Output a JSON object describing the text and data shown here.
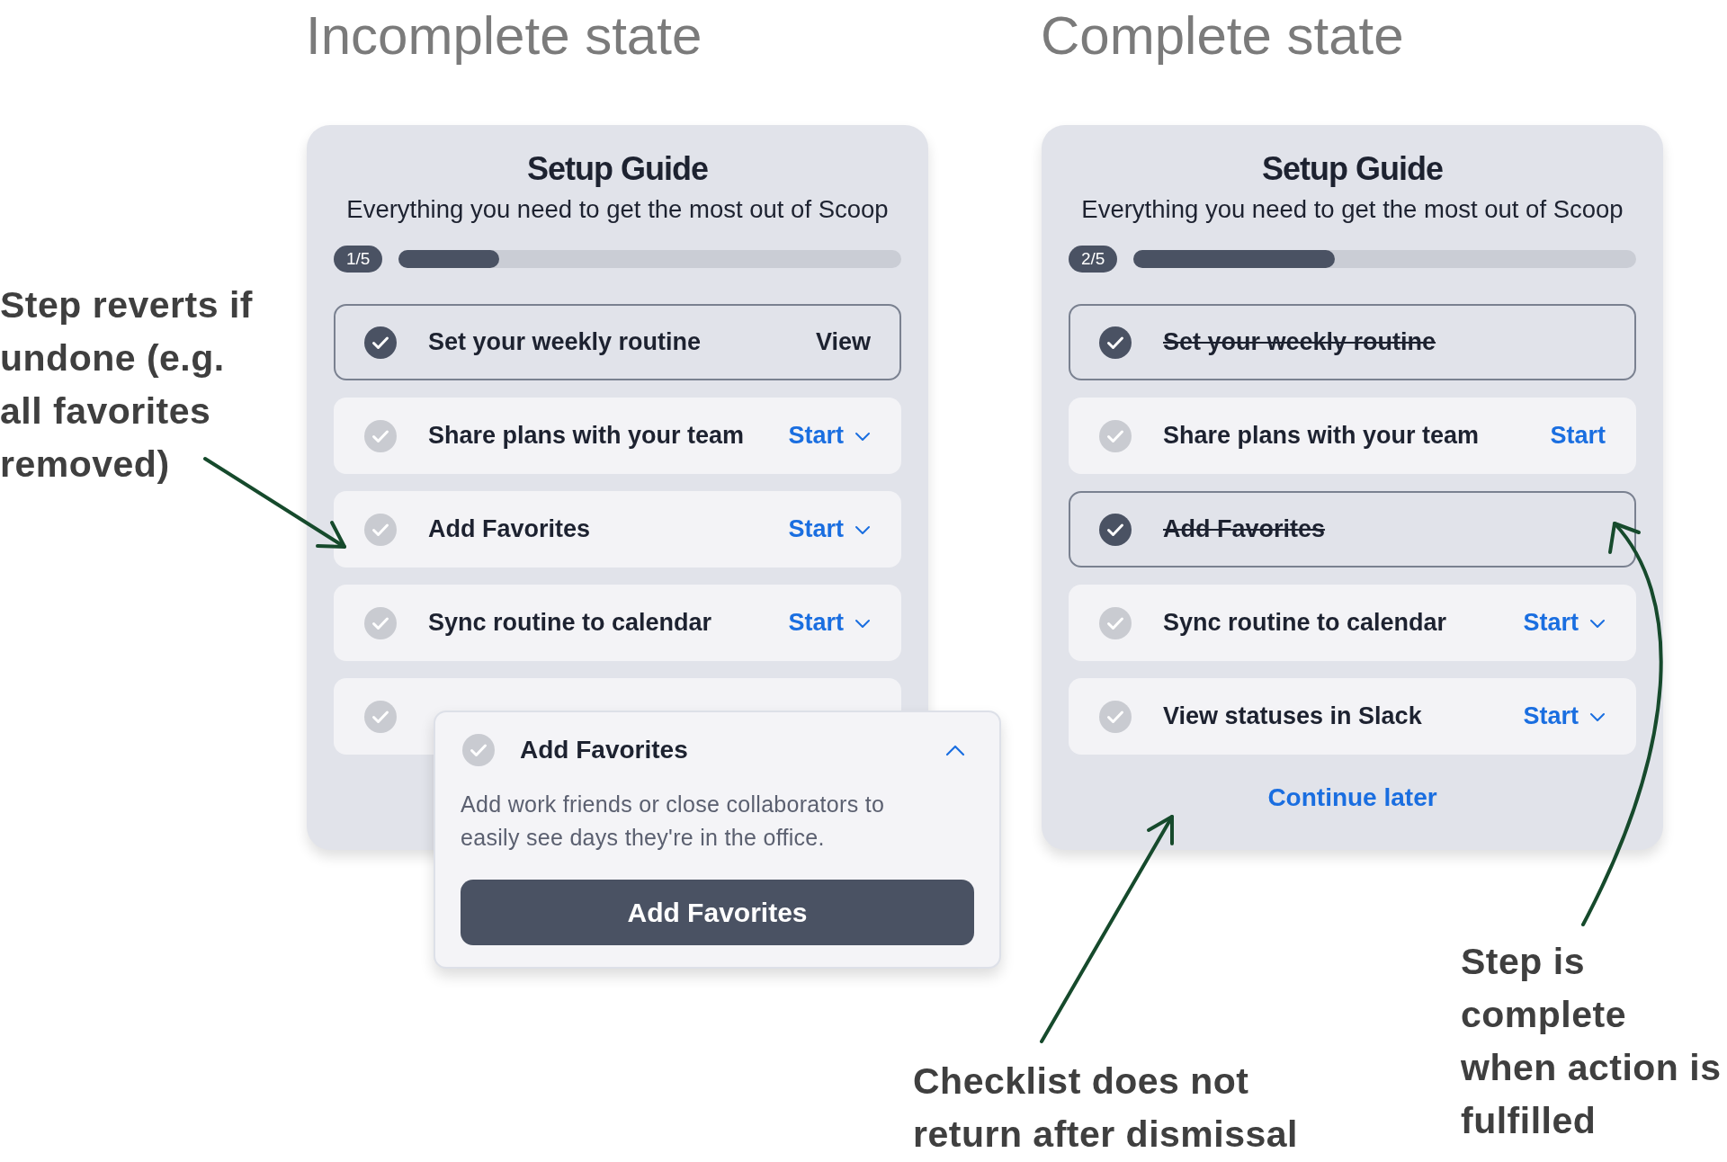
{
  "panels": [
    {
      "heading": "Incomplete state",
      "guide": {
        "title": "Setup Guide",
        "subtitle": "Everything you need to get the most out of Scoop",
        "progress": {
          "text": "1/5",
          "level": 0.2
        },
        "steps": [
          {
            "label": "Set your weekly routine",
            "done": true,
            "struck": false,
            "action": {
              "label": "View",
              "kind": "view",
              "chevron": false
            }
          },
          {
            "label": "Share plans with your team",
            "done": false,
            "struck": false,
            "action": {
              "label": "Start",
              "kind": "start",
              "chevron": true
            }
          },
          {
            "label": "Add Favorites",
            "done": false,
            "struck": false,
            "action": {
              "label": "Start",
              "kind": "start",
              "chevron": true
            }
          },
          {
            "label": "Sync routine to calendar",
            "done": false,
            "struck": false,
            "action": {
              "label": "Start",
              "kind": "start",
              "chevron": true
            }
          },
          {
            "done": false
          }
        ]
      }
    },
    {
      "heading": "Complete state",
      "guide": {
        "title": "Setup Guide",
        "subtitle": "Everything you need to get the most out of Scoop",
        "progress": {
          "text": "2/5",
          "level": 0.4
        },
        "steps": [
          {
            "label": "Set your weekly routine",
            "done": true,
            "struck": true
          },
          {
            "label": "Share plans with your team",
            "done": false,
            "struck": false,
            "action": {
              "label": "Start",
              "kind": "start",
              "chevron": false
            }
          },
          {
            "label": "Add Favorites",
            "done": true,
            "struck": true
          },
          {
            "label": "Sync routine to calendar",
            "done": false,
            "struck": false,
            "action": {
              "label": "Start",
              "kind": "start",
              "chevron": true
            }
          },
          {
            "label": "View statuses in Slack",
            "done": false,
            "struck": false,
            "action": {
              "label": "Start",
              "kind": "start",
              "chevron": true
            }
          }
        ],
        "continue_link": "Continue later"
      }
    }
  ],
  "popover": {
    "title": "Add Favorites",
    "done": false,
    "expanded": true,
    "description": "Add work friends or close collaborators to easily see days they're in the office.",
    "button": "Add Favorites"
  },
  "annotations": [
    {
      "text": "Step reverts if\nundone (e.g.\nall favorites\nremoved)"
    },
    {
      "text": "Checklist does not\nreturn after dismissal"
    },
    {
      "text": "Step is\ncomplete\nwhen action is\nfulfilled"
    }
  ]
}
